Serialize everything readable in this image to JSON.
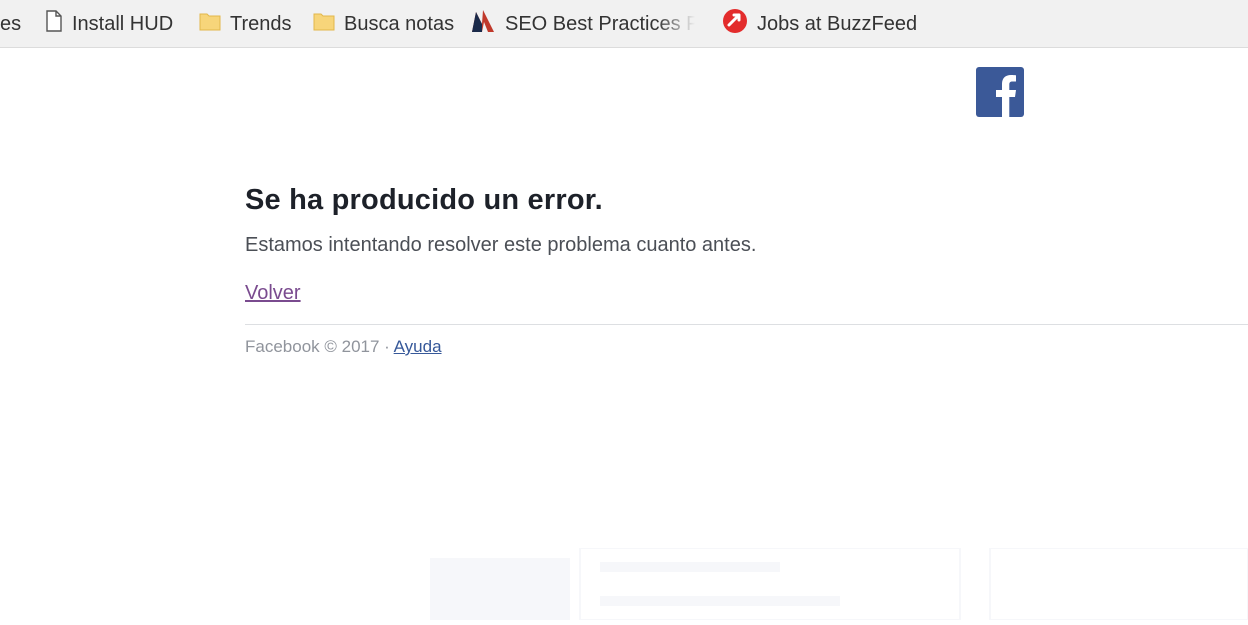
{
  "bookmarks": [
    {
      "label": "es",
      "icon": "cut-off"
    },
    {
      "label": "Install HUD",
      "icon": "page-icon"
    },
    {
      "label": "Trends",
      "icon": "folder-icon"
    },
    {
      "label": "Busca notas",
      "icon": "folder-icon"
    },
    {
      "label": "SEO Best Practices Fo",
      "icon": "n-logo-icon"
    },
    {
      "label": "Jobs at BuzzFeed",
      "icon": "buzzfeed-icon"
    }
  ],
  "brand": {
    "logo": "facebook-logo-icon",
    "color": "#3b5998"
  },
  "error": {
    "title": "Se ha producido un error.",
    "message": "Estamos intentando resolver este problema cuanto antes.",
    "back_link": "Volver"
  },
  "footer": {
    "copyright": "Facebook © 2017 · ",
    "help_link": "Ayuda"
  }
}
